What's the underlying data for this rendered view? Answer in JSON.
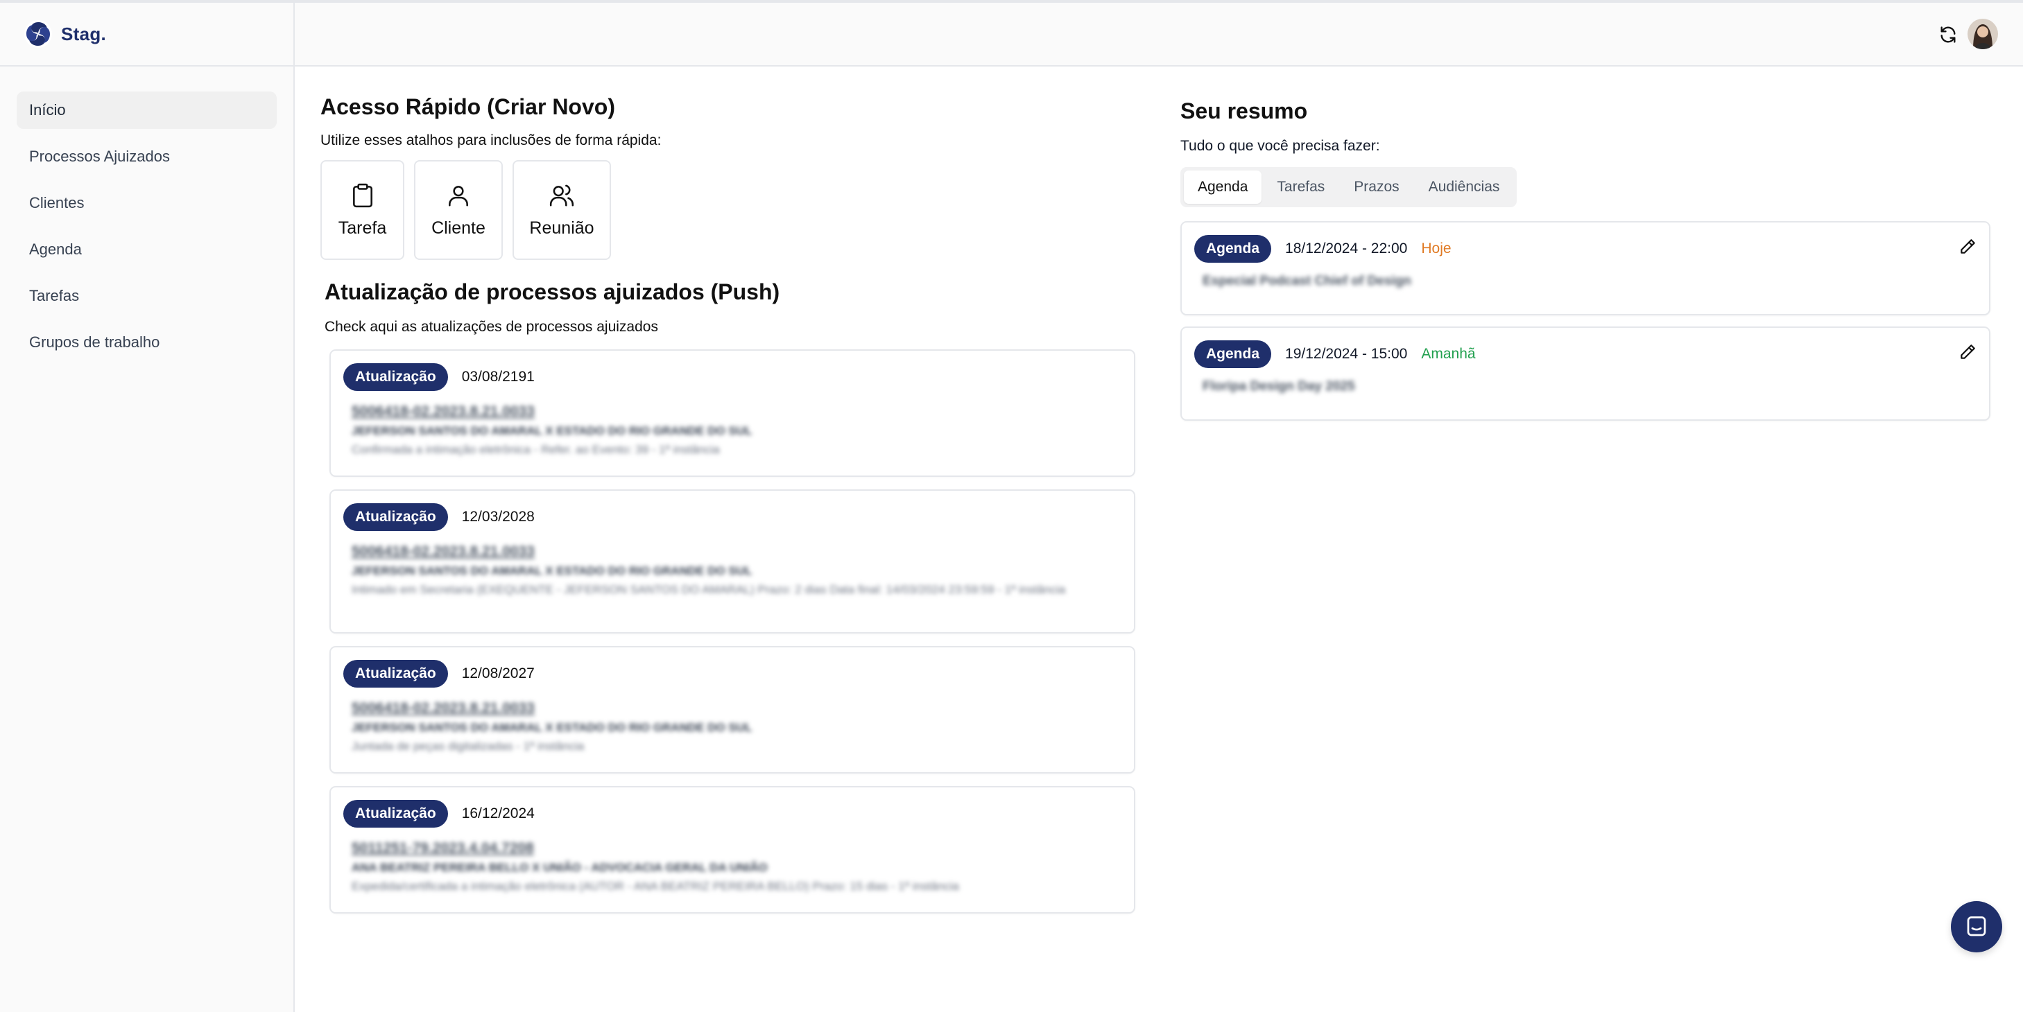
{
  "brand": {
    "name": "Stag."
  },
  "sidebar": {
    "items": [
      {
        "label": "Início"
      },
      {
        "label": "Processos Ajuizados"
      },
      {
        "label": "Clientes"
      },
      {
        "label": "Agenda"
      },
      {
        "label": "Tarefas"
      },
      {
        "label": "Grupos de trabalho"
      }
    ]
  },
  "quick": {
    "title": "Acesso Rápido (Criar Novo)",
    "subtitle": "Utilize esses atalhos para inclusões de forma rápida:",
    "items": [
      {
        "label": "Tarefa",
        "icon": "clipboard-icon"
      },
      {
        "label": "Cliente",
        "icon": "user-icon"
      },
      {
        "label": "Reunião",
        "icon": "users-icon"
      }
    ]
  },
  "push": {
    "title": "Atualização de processos ajuizados (Push)",
    "subtitle": "Check aqui as atualizações de processos ajuizados",
    "updates": [
      {
        "badge": "Atualização",
        "date": "03/08/2191",
        "process": "5006418-02.2023.8.21.0033",
        "parties": "JEFERSON SANTOS DO AMARAL X ESTADO DO RIO GRANDE DO SUL",
        "description": "Confirmada a intimação eletrônica - Refer. ao Evento: 39 - 1ª instância"
      },
      {
        "badge": "Atualização",
        "date": "12/03/2028",
        "process": "5006418-02.2023.8.21.0033",
        "parties": "JEFERSON SANTOS DO AMARAL X ESTADO DO RIO GRANDE DO SUL",
        "description": "Intimado em Secretaria (EXEQUENTE - JEFERSON SANTOS DO AMARAL) Prazo: 2 dias Data final: 14/03/2024 23:59:59 - 1ª instância"
      },
      {
        "badge": "Atualização",
        "date": "12/08/2027",
        "process": "5006418-02.2023.8.21.0033",
        "parties": "JEFERSON SANTOS DO AMARAL X ESTADO DO RIO GRANDE DO SUL",
        "description": "Juntada de peças digitalizadas - 1ª instância"
      },
      {
        "badge": "Atualização",
        "date": "16/12/2024",
        "process": "5011251-79.2023.4.04.7208",
        "parties": "ANA BEATRIZ PEREIRA BELLO X UNIÃO - ADVOCACIA GERAL DA UNIÃO",
        "description": "Expedida/certificada a intimação eletrônica (AUTOR - ANA BEATRIZ PEREIRA BELLO) Prazo: 15 dias - 1ª instância"
      }
    ]
  },
  "resumo": {
    "title": "Seu resumo",
    "subtitle": "Tudo o que você precisa fazer:",
    "tabs": [
      {
        "label": "Agenda",
        "active": true
      },
      {
        "label": "Tarefas",
        "active": false
      },
      {
        "label": "Prazos",
        "active": false
      },
      {
        "label": "Audiências",
        "active": false
      }
    ],
    "items": [
      {
        "badge": "Agenda",
        "when": "18/12/2024 - 22:00",
        "tag": "Hoje",
        "tag_color": "#e07a24",
        "title": "Especial Podcast Chief of Design"
      },
      {
        "badge": "Agenda",
        "when": "19/12/2024 - 15:00",
        "tag": "Amanhã",
        "tag_color": "#22a04f",
        "title": "Floripa Design Day 2025"
      }
    ]
  },
  "colors": {
    "accent": "#1f2f6b",
    "today": "#e07a24",
    "tomorrow": "#22a04f"
  }
}
